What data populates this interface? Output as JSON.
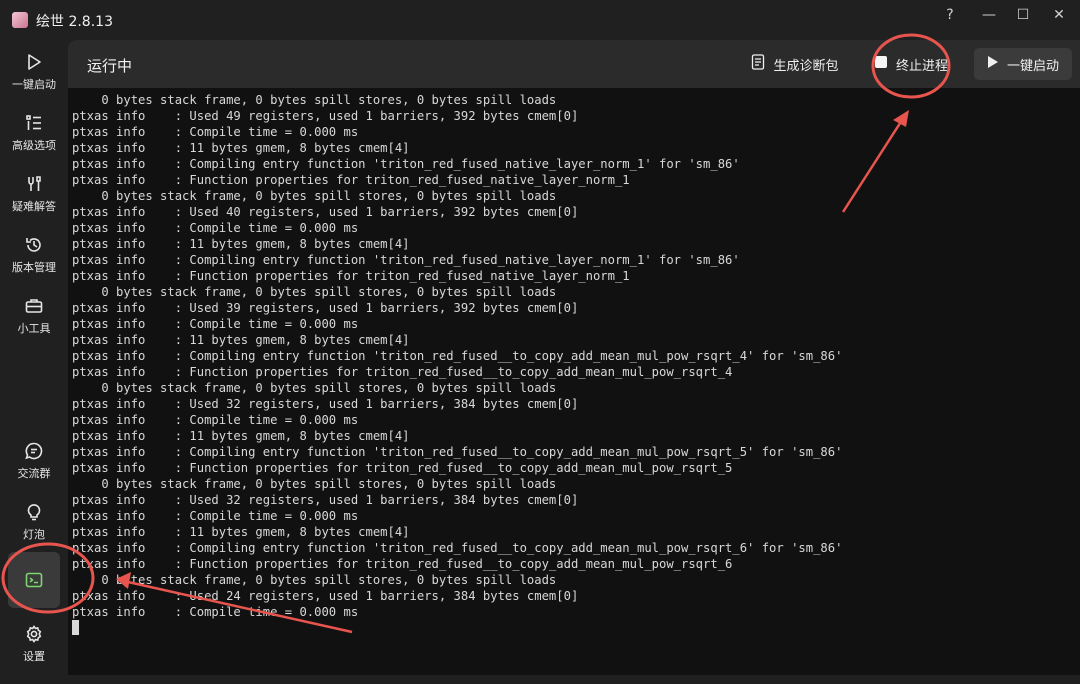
{
  "window": {
    "title": "绘世 2.8.13",
    "controls": {
      "help": "?",
      "minimize": "—",
      "maximize": "☐",
      "close": "✕"
    }
  },
  "sidebar": {
    "items": [
      {
        "label": "一键启动",
        "icon": "play-icon"
      },
      {
        "label": "高级选项",
        "icon": "list-icon"
      },
      {
        "label": "疑难解答",
        "icon": "tools-icon"
      },
      {
        "label": "版本管理",
        "icon": "history-icon"
      },
      {
        "label": "小工具",
        "icon": "toolbox-icon"
      },
      {
        "label": "交流群",
        "icon": "chat-icon"
      },
      {
        "label": "灯泡",
        "icon": "bulb-icon"
      },
      {
        "label": "",
        "icon": "console-icon",
        "active": true
      },
      {
        "label": "设置",
        "icon": "gear-icon"
      }
    ]
  },
  "header": {
    "title": "运行中",
    "buttons": {
      "diagnostics": "生成诊断包",
      "stop": "终止进程",
      "launch": "一键启动"
    }
  },
  "console": {
    "lines": [
      "    0 bytes stack frame, 0 bytes spill stores, 0 bytes spill loads",
      "ptxas info    : Used 49 registers, used 1 barriers, 392 bytes cmem[0]",
      "ptxas info    : Compile time = 0.000 ms",
      "ptxas info    : 11 bytes gmem, 8 bytes cmem[4]",
      "ptxas info    : Compiling entry function 'triton_red_fused_native_layer_norm_1' for 'sm_86'",
      "ptxas info    : Function properties for triton_red_fused_native_layer_norm_1",
      "    0 bytes stack frame, 0 bytes spill stores, 0 bytes spill loads",
      "ptxas info    : Used 40 registers, used 1 barriers, 392 bytes cmem[0]",
      "ptxas info    : Compile time = 0.000 ms",
      "ptxas info    : 11 bytes gmem, 8 bytes cmem[4]",
      "ptxas info    : Compiling entry function 'triton_red_fused_native_layer_norm_1' for 'sm_86'",
      "ptxas info    : Function properties for triton_red_fused_native_layer_norm_1",
      "    0 bytes stack frame, 0 bytes spill stores, 0 bytes spill loads",
      "ptxas info    : Used 39 registers, used 1 barriers, 392 bytes cmem[0]",
      "ptxas info    : Compile time = 0.000 ms",
      "ptxas info    : 11 bytes gmem, 8 bytes cmem[4]",
      "ptxas info    : Compiling entry function 'triton_red_fused__to_copy_add_mean_mul_pow_rsqrt_4' for 'sm_86'",
      "ptxas info    : Function properties for triton_red_fused__to_copy_add_mean_mul_pow_rsqrt_4",
      "    0 bytes stack frame, 0 bytes spill stores, 0 bytes spill loads",
      "ptxas info    : Used 32 registers, used 1 barriers, 384 bytes cmem[0]",
      "ptxas info    : Compile time = 0.000 ms",
      "ptxas info    : 11 bytes gmem, 8 bytes cmem[4]",
      "ptxas info    : Compiling entry function 'triton_red_fused__to_copy_add_mean_mul_pow_rsqrt_5' for 'sm_86'",
      "ptxas info    : Function properties for triton_red_fused__to_copy_add_mean_mul_pow_rsqrt_5",
      "    0 bytes stack frame, 0 bytes spill stores, 0 bytes spill loads",
      "ptxas info    : Used 32 registers, used 1 barriers, 384 bytes cmem[0]",
      "ptxas info    : Compile time = 0.000 ms",
      "ptxas info    : 11 bytes gmem, 8 bytes cmem[4]",
      "ptxas info    : Compiling entry function 'triton_red_fused__to_copy_add_mean_mul_pow_rsqrt_6' for 'sm_86'",
      "ptxas info    : Function properties for triton_red_fused__to_copy_add_mean_mul_pow_rsqrt_6",
      "    0 bytes stack frame, 0 bytes spill stores, 0 bytes spill loads",
      "ptxas info    : Used 24 registers, used 1 barriers, 384 bytes cmem[0]",
      "ptxas info    : Compile time = 0.000 ms"
    ]
  },
  "colors": {
    "background": "#202020",
    "panel": "#111111",
    "header": "#2b2b2b",
    "annotation": "#e8554e",
    "active_icon": "#7dd56f"
  }
}
